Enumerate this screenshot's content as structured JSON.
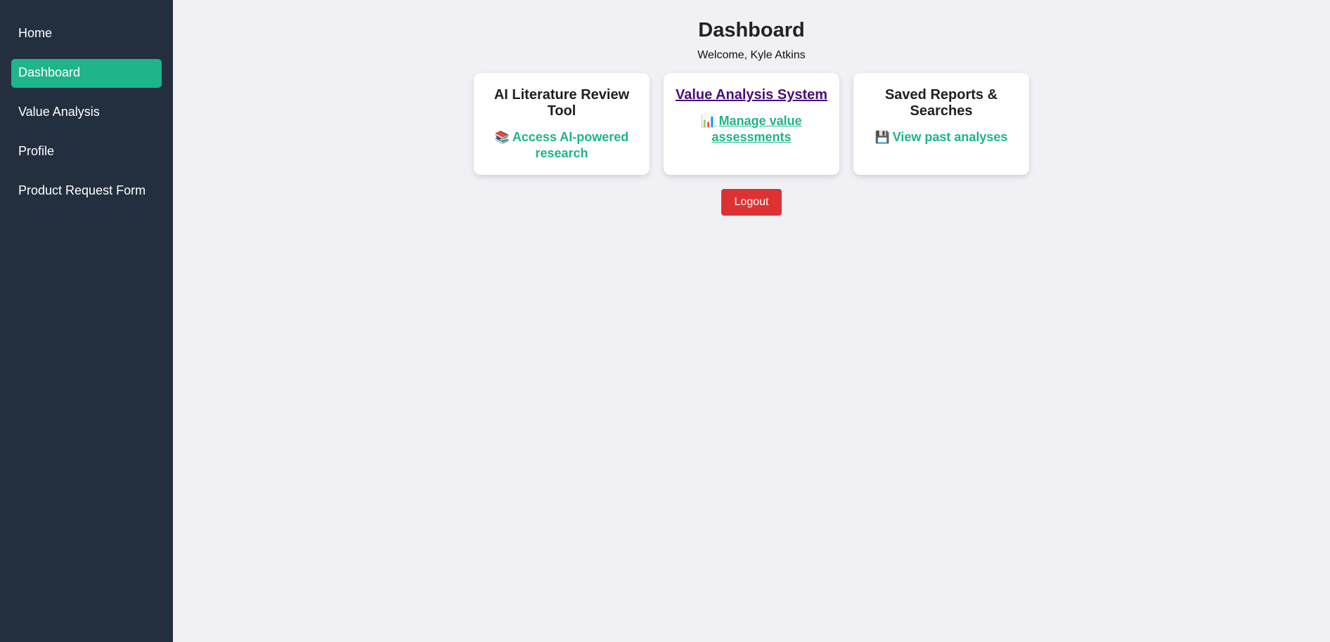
{
  "sidebar": {
    "items": [
      {
        "label": "Home"
      },
      {
        "label": "Dashboard"
      },
      {
        "label": "Value Analysis"
      },
      {
        "label": "Profile"
      },
      {
        "label": "Product Request Form"
      }
    ]
  },
  "header": {
    "title": "Dashboard",
    "welcome": "Welcome, Kyle Atkins"
  },
  "cards": [
    {
      "title": "AI Literature Review Tool",
      "icon": "books-icon",
      "icon_glyph": "📚",
      "link": "Access AI-powered research"
    },
    {
      "title": "Value Analysis System",
      "icon": "bar-chart-icon",
      "icon_glyph": "📊",
      "link": "Manage value assessments"
    },
    {
      "title": "Saved Reports & Searches",
      "icon": "floppy-disk-icon",
      "icon_glyph": "💾",
      "link": "View past analyses"
    }
  ],
  "actions": {
    "logout_label": "Logout"
  },
  "colors": {
    "sidebar_bg": "#232f3e",
    "accent": "#1db589",
    "logout": "#de3232",
    "background": "#f0f0f5",
    "visited_link": "#4b0d7a"
  }
}
